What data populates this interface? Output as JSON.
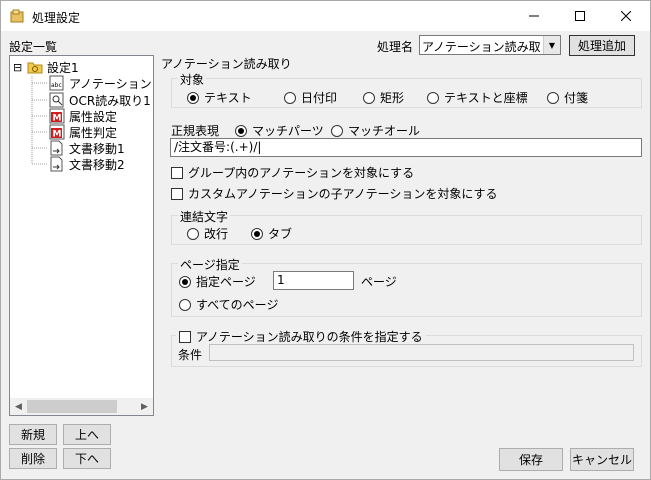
{
  "window": {
    "title": "処理設定",
    "minimize_glyph": "—",
    "maximize_glyph": "☐",
    "close_glyph": "✕"
  },
  "left": {
    "list_label": "設定一覧",
    "tree": [
      {
        "label": "設定1",
        "icon": "folder-icon",
        "expander": "⊟"
      },
      {
        "label": "アノテーション",
        "icon": "annotation-icon"
      },
      {
        "label": "OCR読み取り1",
        "icon": "ocr-icon"
      },
      {
        "label": "属性設定",
        "icon": "attribute-set-icon"
      },
      {
        "label": "属性判定",
        "icon": "attribute-judge-icon"
      },
      {
        "label": "文書移動1",
        "icon": "document-move-icon"
      },
      {
        "label": "文書移動2",
        "icon": "document-move-icon"
      }
    ],
    "buttons": {
      "new": "新規",
      "up": "上へ",
      "delete": "削除",
      "down": "下へ"
    }
  },
  "header": {
    "process_name_label": "処理名",
    "process_name_value": "アノテーション読み取り",
    "add_process_button": "処理追加"
  },
  "panel": {
    "section_title": "アノテーション読み取り",
    "target": {
      "legend": "対象",
      "options": [
        "テキスト",
        "日付印",
        "矩形",
        "テキストと座標",
        "付箋"
      ],
      "selected": 0
    },
    "regex": {
      "label": "正規表現",
      "options": [
        "マッチパーツ",
        "マッチオール"
      ],
      "selected": 0,
      "value": "/注文番号:(.+)/|"
    },
    "checks": [
      {
        "label": "グループ内のアノテーションを対象にする",
        "checked": false
      },
      {
        "label": "カスタムアノテーションの子アノテーションを対象にする",
        "checked": false
      }
    ],
    "join": {
      "legend": "連結文字",
      "options": [
        "改行",
        "タブ"
      ],
      "selected": 1
    },
    "page": {
      "legend": "ページ指定",
      "option_specified": "指定ページ",
      "page_value": "1",
      "page_suffix": "ページ",
      "option_all": "すべてのページ",
      "selected": 0
    },
    "condition": {
      "legend": "アノテーション読み取りの条件を指定する",
      "label": "条件",
      "value": ""
    }
  },
  "footer": {
    "save": "保存",
    "cancel": "キャンセル"
  }
}
